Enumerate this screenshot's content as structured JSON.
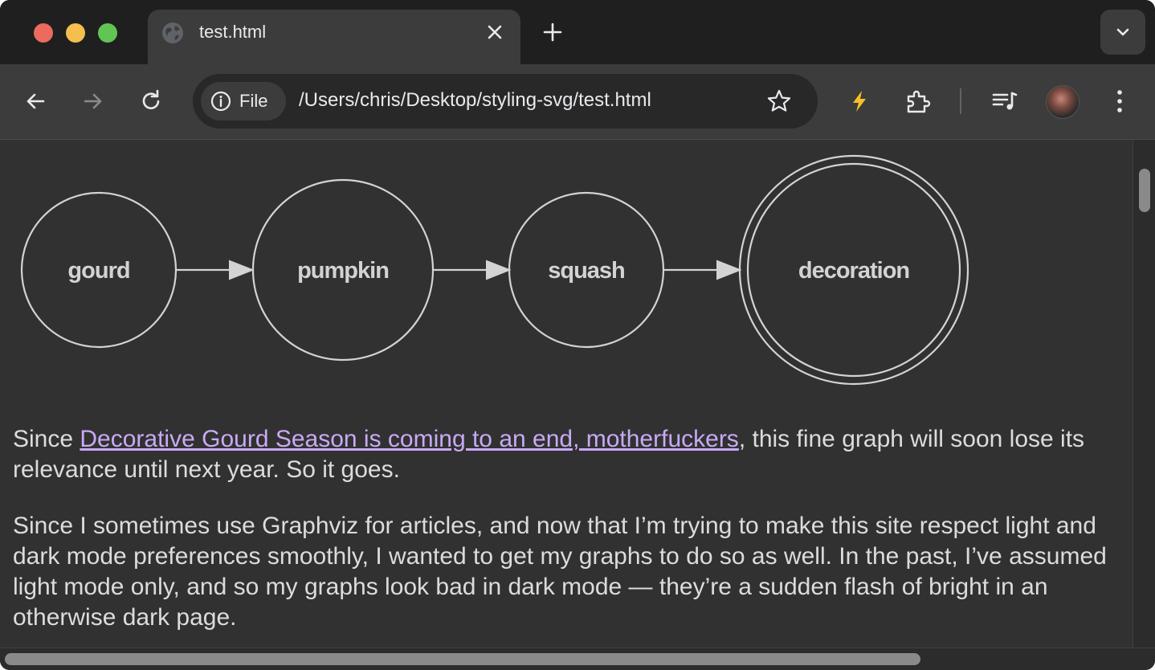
{
  "tab": {
    "title": "test.html"
  },
  "toolbar": {
    "chip_label": "File",
    "url": "/Users/chris/Desktop/styling-svg/test.html"
  },
  "graph": {
    "nodes": [
      "gourd",
      "pumpkin",
      "squash",
      "decoration"
    ]
  },
  "content": {
    "p1_before": "Since ",
    "p1_link": "Decorative Gourd Season is coming to an end, motherfuckers",
    "p1_after": ", this fine graph will soon lose its relevance until next year. So it goes.",
    "p2": "Since I sometimes use Graphviz for articles, and now that I’m trying to make this site respect light and dark mode preferences smoothly, I wanted to get my graphs to do so as well. In the past, I’ve assumed light mode only, and so my graphs look bad in dark mode — they’re a sudden flash of bright in an otherwise dark page."
  },
  "colors": {
    "page_bg": "#313131",
    "text": "#dcdcdc",
    "link": "#c9a9f5",
    "graph_stroke": "#d3d3d3"
  },
  "icons": [
    "globe-icon",
    "close-icon",
    "plus-icon",
    "chevron-down-icon",
    "back-arrow-icon",
    "forward-arrow-icon",
    "reload-icon",
    "info-icon",
    "star-icon",
    "lightning-icon",
    "puzzle-icon",
    "media-queue-icon",
    "kebab-menu-icon"
  ]
}
